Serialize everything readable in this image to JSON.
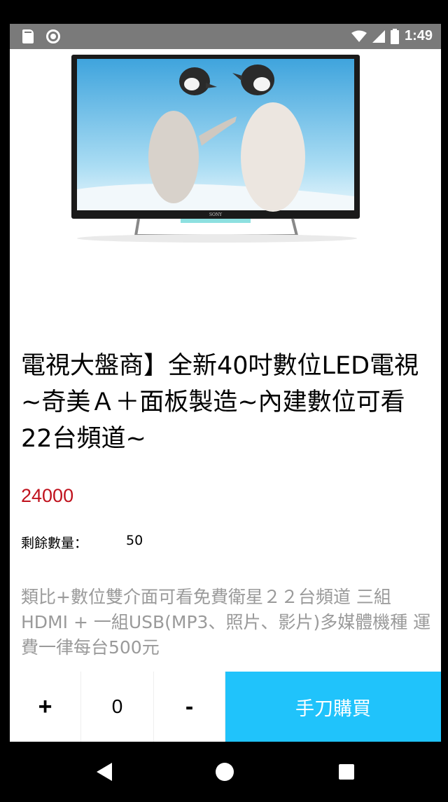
{
  "status_bar": {
    "time": "1:49",
    "icons": [
      "sd-card-icon",
      "record-icon",
      "wifi-icon",
      "signal-icon",
      "battery-icon"
    ]
  },
  "product": {
    "image": {
      "subject": "sony-tv-with-penguins",
      "brand_text": "SONY"
    },
    "title": "電視大盤商】全新40吋數位LED電視 ~奇美Ａ＋面板製造~內建數位可看22台頻道~",
    "price": "24000",
    "stock_label": "剩餘數量：",
    "stock_value": "50",
    "description": "類比+數位雙介面可看免費衛星２２台頻道 三組HDMI + 一組USB(MP3、照片、影片)多媒體機種  運費一律每台500元"
  },
  "action_bar": {
    "plus_label": "+",
    "quantity": "0",
    "minus_label": "-",
    "buy_label": "手刀購買"
  },
  "colors": {
    "price": "#c0121d",
    "buy_button": "#20c3fb",
    "status_bar": "#7a7a7a",
    "description": "#9a9a9a"
  }
}
